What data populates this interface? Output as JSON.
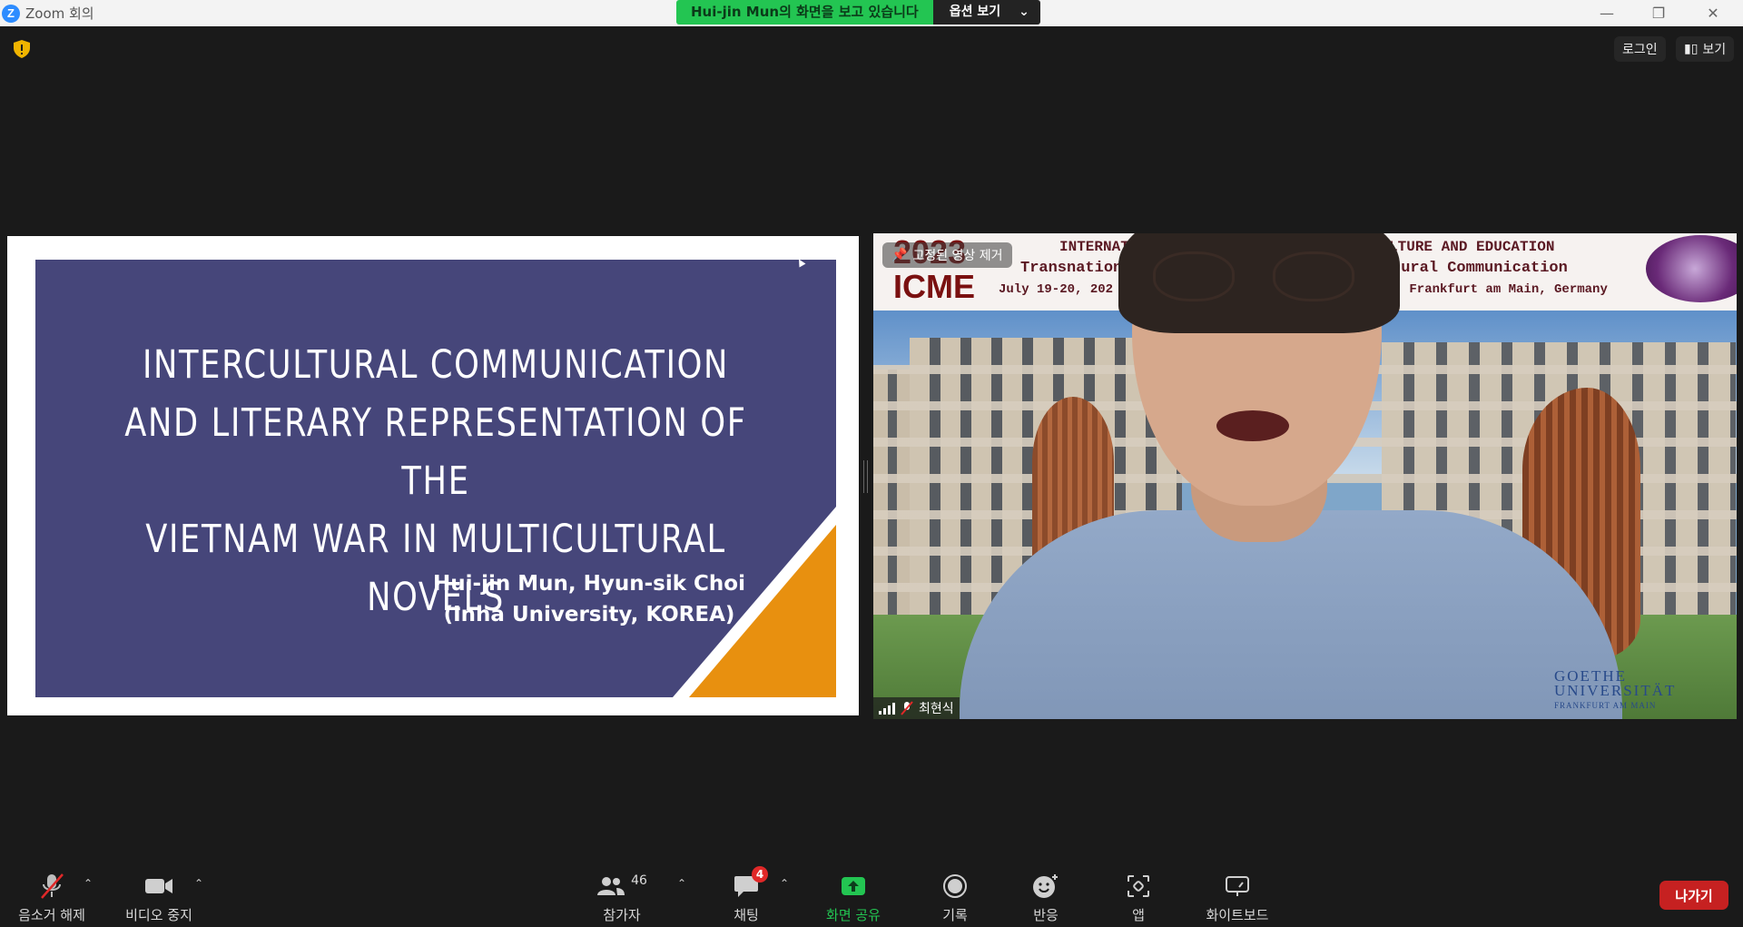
{
  "window": {
    "title": "Zoom 회의"
  },
  "share_banner": {
    "viewing": "Hui-jin  Mun의 화면을 보고 있습니다",
    "options": "옵션 보기"
  },
  "top_buttons": {
    "login": "로그인",
    "view": "보기"
  },
  "slide": {
    "title_lines": [
      "INTERCULTURAL COMMUNICATION",
      "AND LITERARY REPRESENTATION OF THE",
      "VIETNAM WAR IN MULTICULTURAL NOVELS"
    ],
    "authors": "Hui-jin Mun, Hyun-sik Choi",
    "affiliation": "(Inha University, KOREA)"
  },
  "video": {
    "pin_label": "고정된 영상 제거",
    "participant_name": "최현식",
    "banner": {
      "year": "2023",
      "acronym": "ICME",
      "line1": "INTERNATIC",
      "line1b": "LTICULTURE AND EDUCATION",
      "line2": "Transnation",
      "line2b": "ercultural Communication",
      "line3": "July 19-20, 202",
      "line3b": "furt, Frankfurt am Main, Germany"
    },
    "university_logo": {
      "line1": "GOETHE",
      "line2": "UNIVERSITÄT",
      "line3": "FRANKFURT AM MAIN"
    }
  },
  "toolbar": {
    "unmute": "음소거 해제",
    "stop_video": "비디오 중지",
    "participants": "참가자",
    "participants_count": "46",
    "chat": "채팅",
    "chat_badge": "4",
    "share_screen": "화면 공유",
    "record": "기록",
    "reactions": "반응",
    "apps": "앱",
    "whiteboard": "화이트보드",
    "leave": "나가기"
  },
  "colors": {
    "share_green": "#23c552",
    "leave_red": "#c62121",
    "slide_bg": "#46467a",
    "slide_accent": "#e8900f"
  }
}
